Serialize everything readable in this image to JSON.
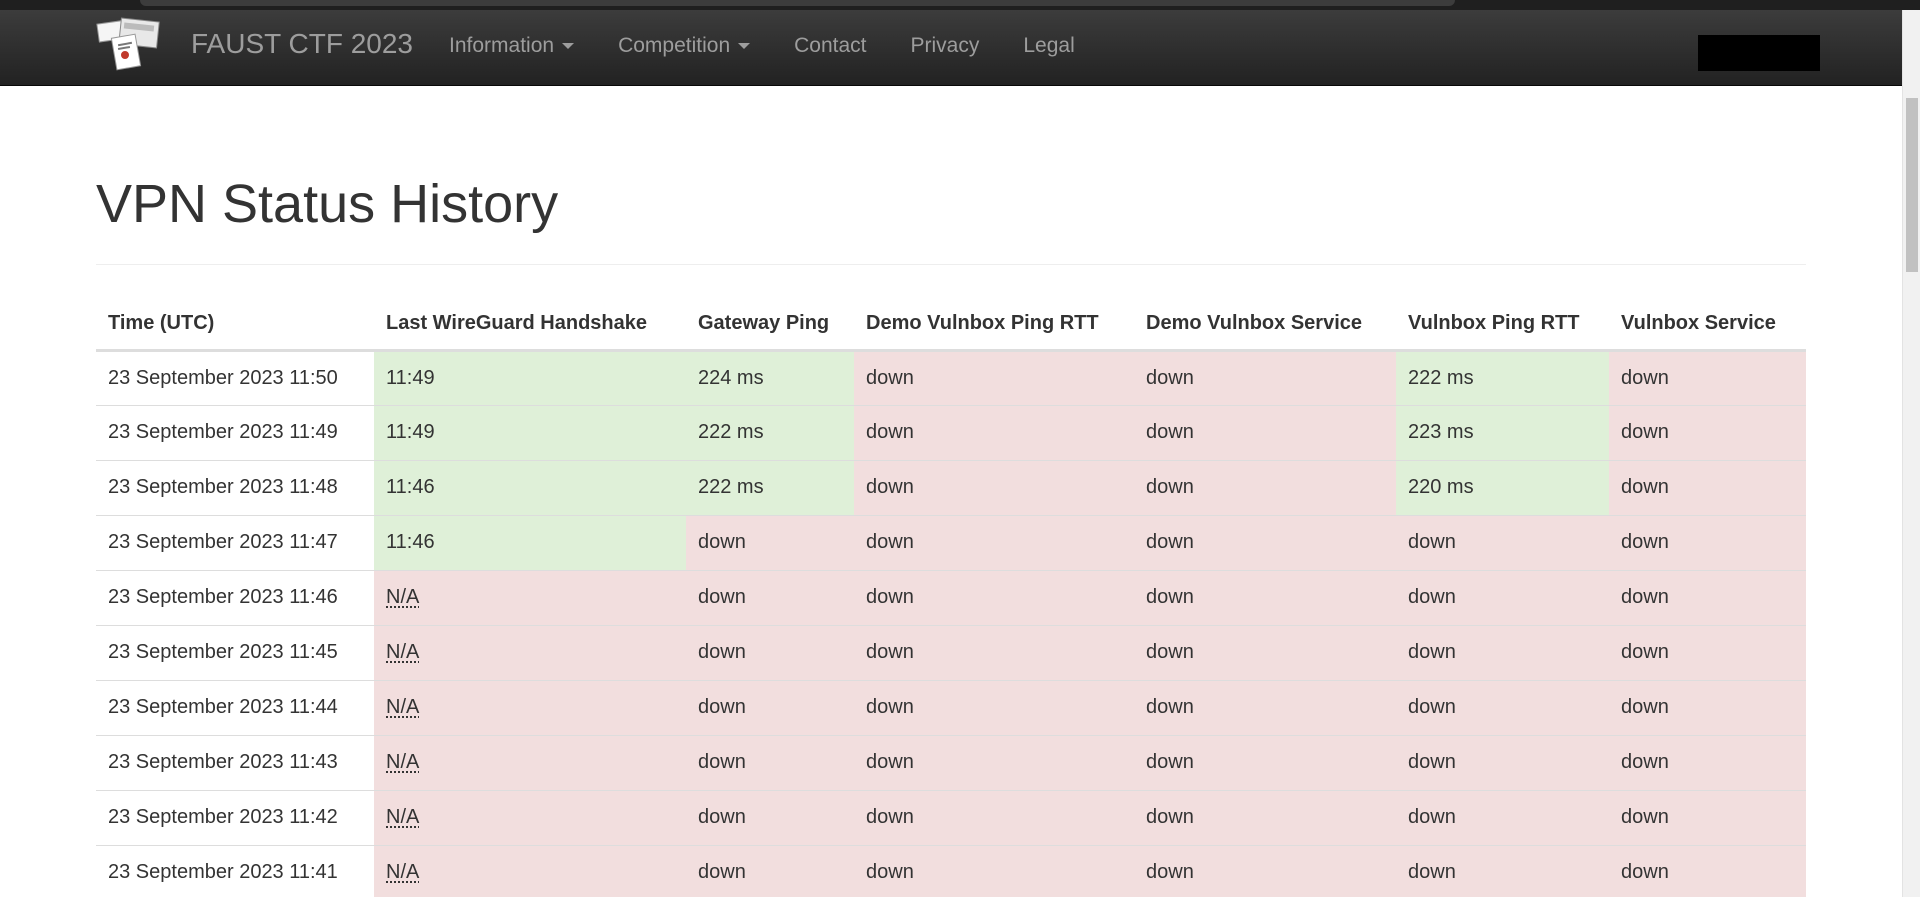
{
  "app": {
    "brand": "FAUST CTF 2023"
  },
  "nav": {
    "items": [
      {
        "label": "Information",
        "dropdown": true
      },
      {
        "label": "Competition",
        "dropdown": true
      },
      {
        "label": "Contact",
        "dropdown": false
      },
      {
        "label": "Privacy",
        "dropdown": false
      },
      {
        "label": "Legal",
        "dropdown": false
      }
    ]
  },
  "page": {
    "title": "VPN Status History"
  },
  "table": {
    "columns": [
      "Time (UTC)",
      "Last WireGuard Handshake",
      "Gateway Ping",
      "Demo Vulnbox Ping RTT",
      "Demo Vulnbox Service",
      "Vulnbox Ping RTT",
      "Vulnbox Service"
    ],
    "rows": [
      {
        "time": "23 September 2023 11:50",
        "handshake": "11:49",
        "gateway_ping": "224 ms",
        "demo_ping": "down",
        "demo_service": "down",
        "vulnbox_ping": "222 ms",
        "vulnbox_service": "down"
      },
      {
        "time": "23 September 2023 11:49",
        "handshake": "11:49",
        "gateway_ping": "222 ms",
        "demo_ping": "down",
        "demo_service": "down",
        "vulnbox_ping": "223 ms",
        "vulnbox_service": "down"
      },
      {
        "time": "23 September 2023 11:48",
        "handshake": "11:46",
        "gateway_ping": "222 ms",
        "demo_ping": "down",
        "demo_service": "down",
        "vulnbox_ping": "220 ms",
        "vulnbox_service": "down"
      },
      {
        "time": "23 September 2023 11:47",
        "handshake": "11:46",
        "gateway_ping": "down",
        "demo_ping": "down",
        "demo_service": "down",
        "vulnbox_ping": "down",
        "vulnbox_service": "down"
      },
      {
        "time": "23 September 2023 11:46",
        "handshake": "N/A",
        "gateway_ping": "down",
        "demo_ping": "down",
        "demo_service": "down",
        "vulnbox_ping": "down",
        "vulnbox_service": "down"
      },
      {
        "time": "23 September 2023 11:45",
        "handshake": "N/A",
        "gateway_ping": "down",
        "demo_ping": "down",
        "demo_service": "down",
        "vulnbox_ping": "down",
        "vulnbox_service": "down"
      },
      {
        "time": "23 September 2023 11:44",
        "handshake": "N/A",
        "gateway_ping": "down",
        "demo_ping": "down",
        "demo_service": "down",
        "vulnbox_ping": "down",
        "vulnbox_service": "down"
      },
      {
        "time": "23 September 2023 11:43",
        "handshake": "N/A",
        "gateway_ping": "down",
        "demo_ping": "down",
        "demo_service": "down",
        "vulnbox_ping": "down",
        "vulnbox_service": "down"
      },
      {
        "time": "23 September 2023 11:42",
        "handshake": "N/A",
        "gateway_ping": "down",
        "demo_ping": "down",
        "demo_service": "down",
        "vulnbox_ping": "down",
        "vulnbox_service": "down"
      },
      {
        "time": "23 September 2023 11:41",
        "handshake": "N/A",
        "gateway_ping": "down",
        "demo_ping": "down",
        "demo_service": "down",
        "vulnbox_ping": "down",
        "vulnbox_service": "down"
      }
    ]
  },
  "colors": {
    "navbar": "#222222",
    "success_cell": "#dff0d8",
    "danger_cell": "#f2dede",
    "nav_text": "#9d9d9d"
  }
}
